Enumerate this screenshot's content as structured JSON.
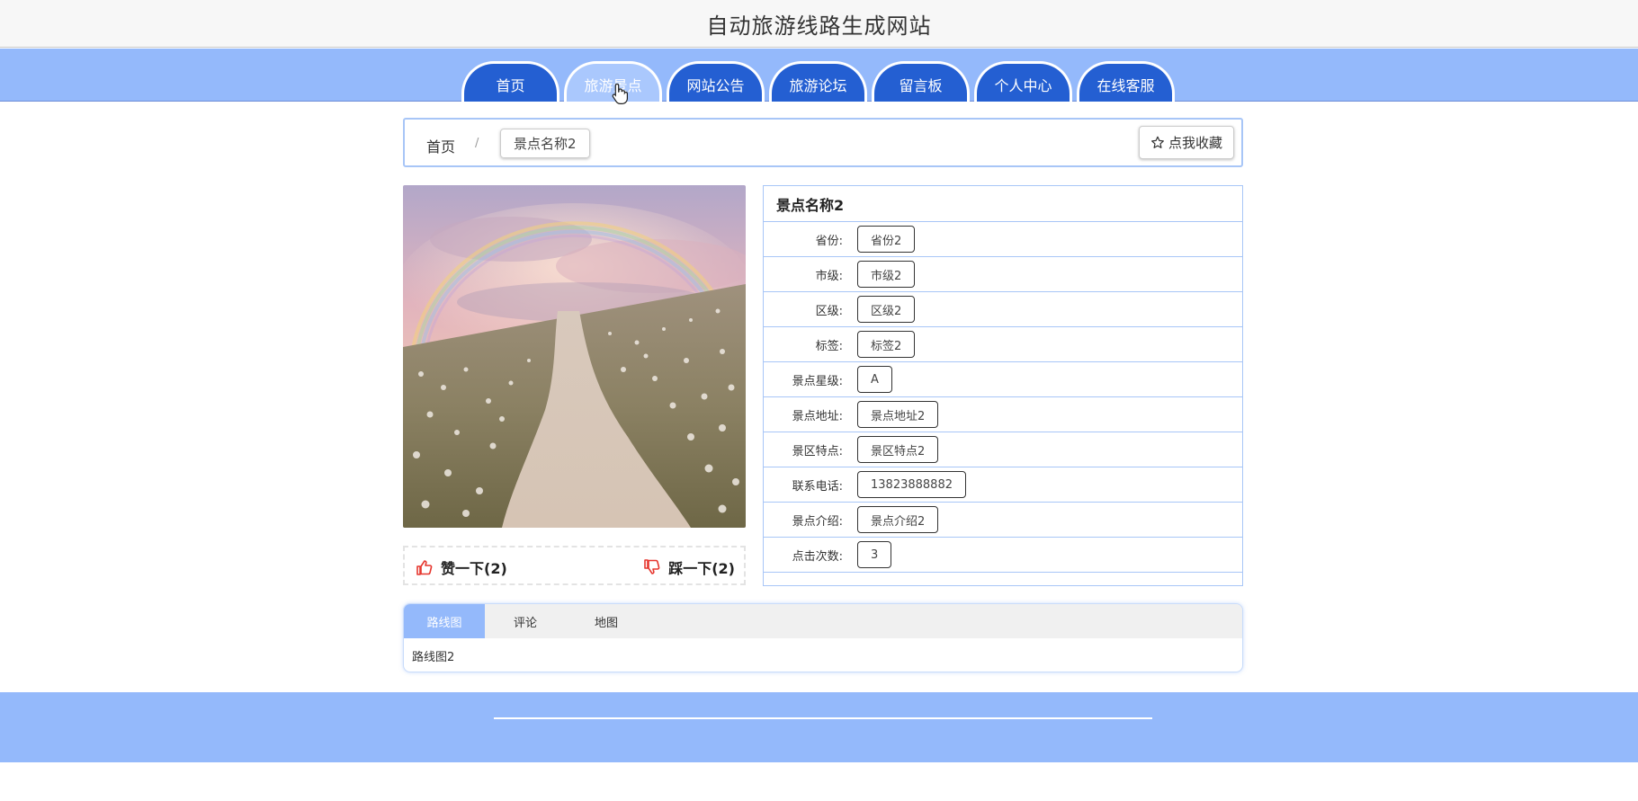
{
  "site": {
    "title": "自动旅游线路生成网站"
  },
  "nav": {
    "items": [
      {
        "label": "首页"
      },
      {
        "label": "旅游景点"
      },
      {
        "label": "网站公告"
      },
      {
        "label": "旅游论坛"
      },
      {
        "label": "留言板"
      },
      {
        "label": "个人中心"
      },
      {
        "label": "在线客服"
      }
    ],
    "active_index": 1
  },
  "breadcrumb": {
    "home": "首页",
    "separator": "/",
    "current": "景点名称2",
    "favorite_label": "点我收藏"
  },
  "scene": {
    "name": "景点名称2",
    "fields": [
      {
        "label": "省份:",
        "value": "省份2"
      },
      {
        "label": "市级:",
        "value": "市级2"
      },
      {
        "label": "区级:",
        "value": "区级2"
      },
      {
        "label": "标签:",
        "value": "标签2"
      },
      {
        "label": "景点星级:",
        "value": "A"
      },
      {
        "label": "景点地址:",
        "value": "景点地址2"
      },
      {
        "label": "景区特点:",
        "value": "景区特点2"
      },
      {
        "label": "联系电话:",
        "value": "13823888882"
      },
      {
        "label": "景点介绍:",
        "value": "景点介绍2"
      },
      {
        "label": "点击次数:",
        "value": "3"
      }
    ]
  },
  "votes": {
    "like_label": "赞一下(2)",
    "dislike_label": "踩一下(2)"
  },
  "tabs": {
    "items": [
      {
        "label": "路线图"
      },
      {
        "label": "评论"
      },
      {
        "label": "地图"
      }
    ],
    "active_index": 0,
    "content": "路线图2"
  },
  "colors": {
    "nav_bg": "#94b9fb",
    "nav_item": "#245fd2",
    "border_blue": "#a8c6f7"
  }
}
